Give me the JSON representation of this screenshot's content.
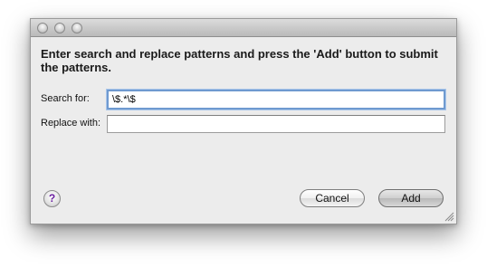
{
  "dialog": {
    "message": "Enter search and replace patterns and press the 'Add' button to submit the patterns.",
    "search_label": "Search for:",
    "search_value": "\\$.*\\$",
    "replace_label": "Replace with:",
    "replace_value": "",
    "help_label": "?",
    "cancel_label": "Cancel",
    "add_label": "Add"
  },
  "icons": {
    "close": "close-icon",
    "minimize": "minimize-icon",
    "zoom": "zoom-icon",
    "resize": "resize-grip-icon"
  },
  "colors": {
    "window_background": "#ececec",
    "focus_ring": "#6f9ad0",
    "help_question_mark": "#6a1fa0"
  }
}
